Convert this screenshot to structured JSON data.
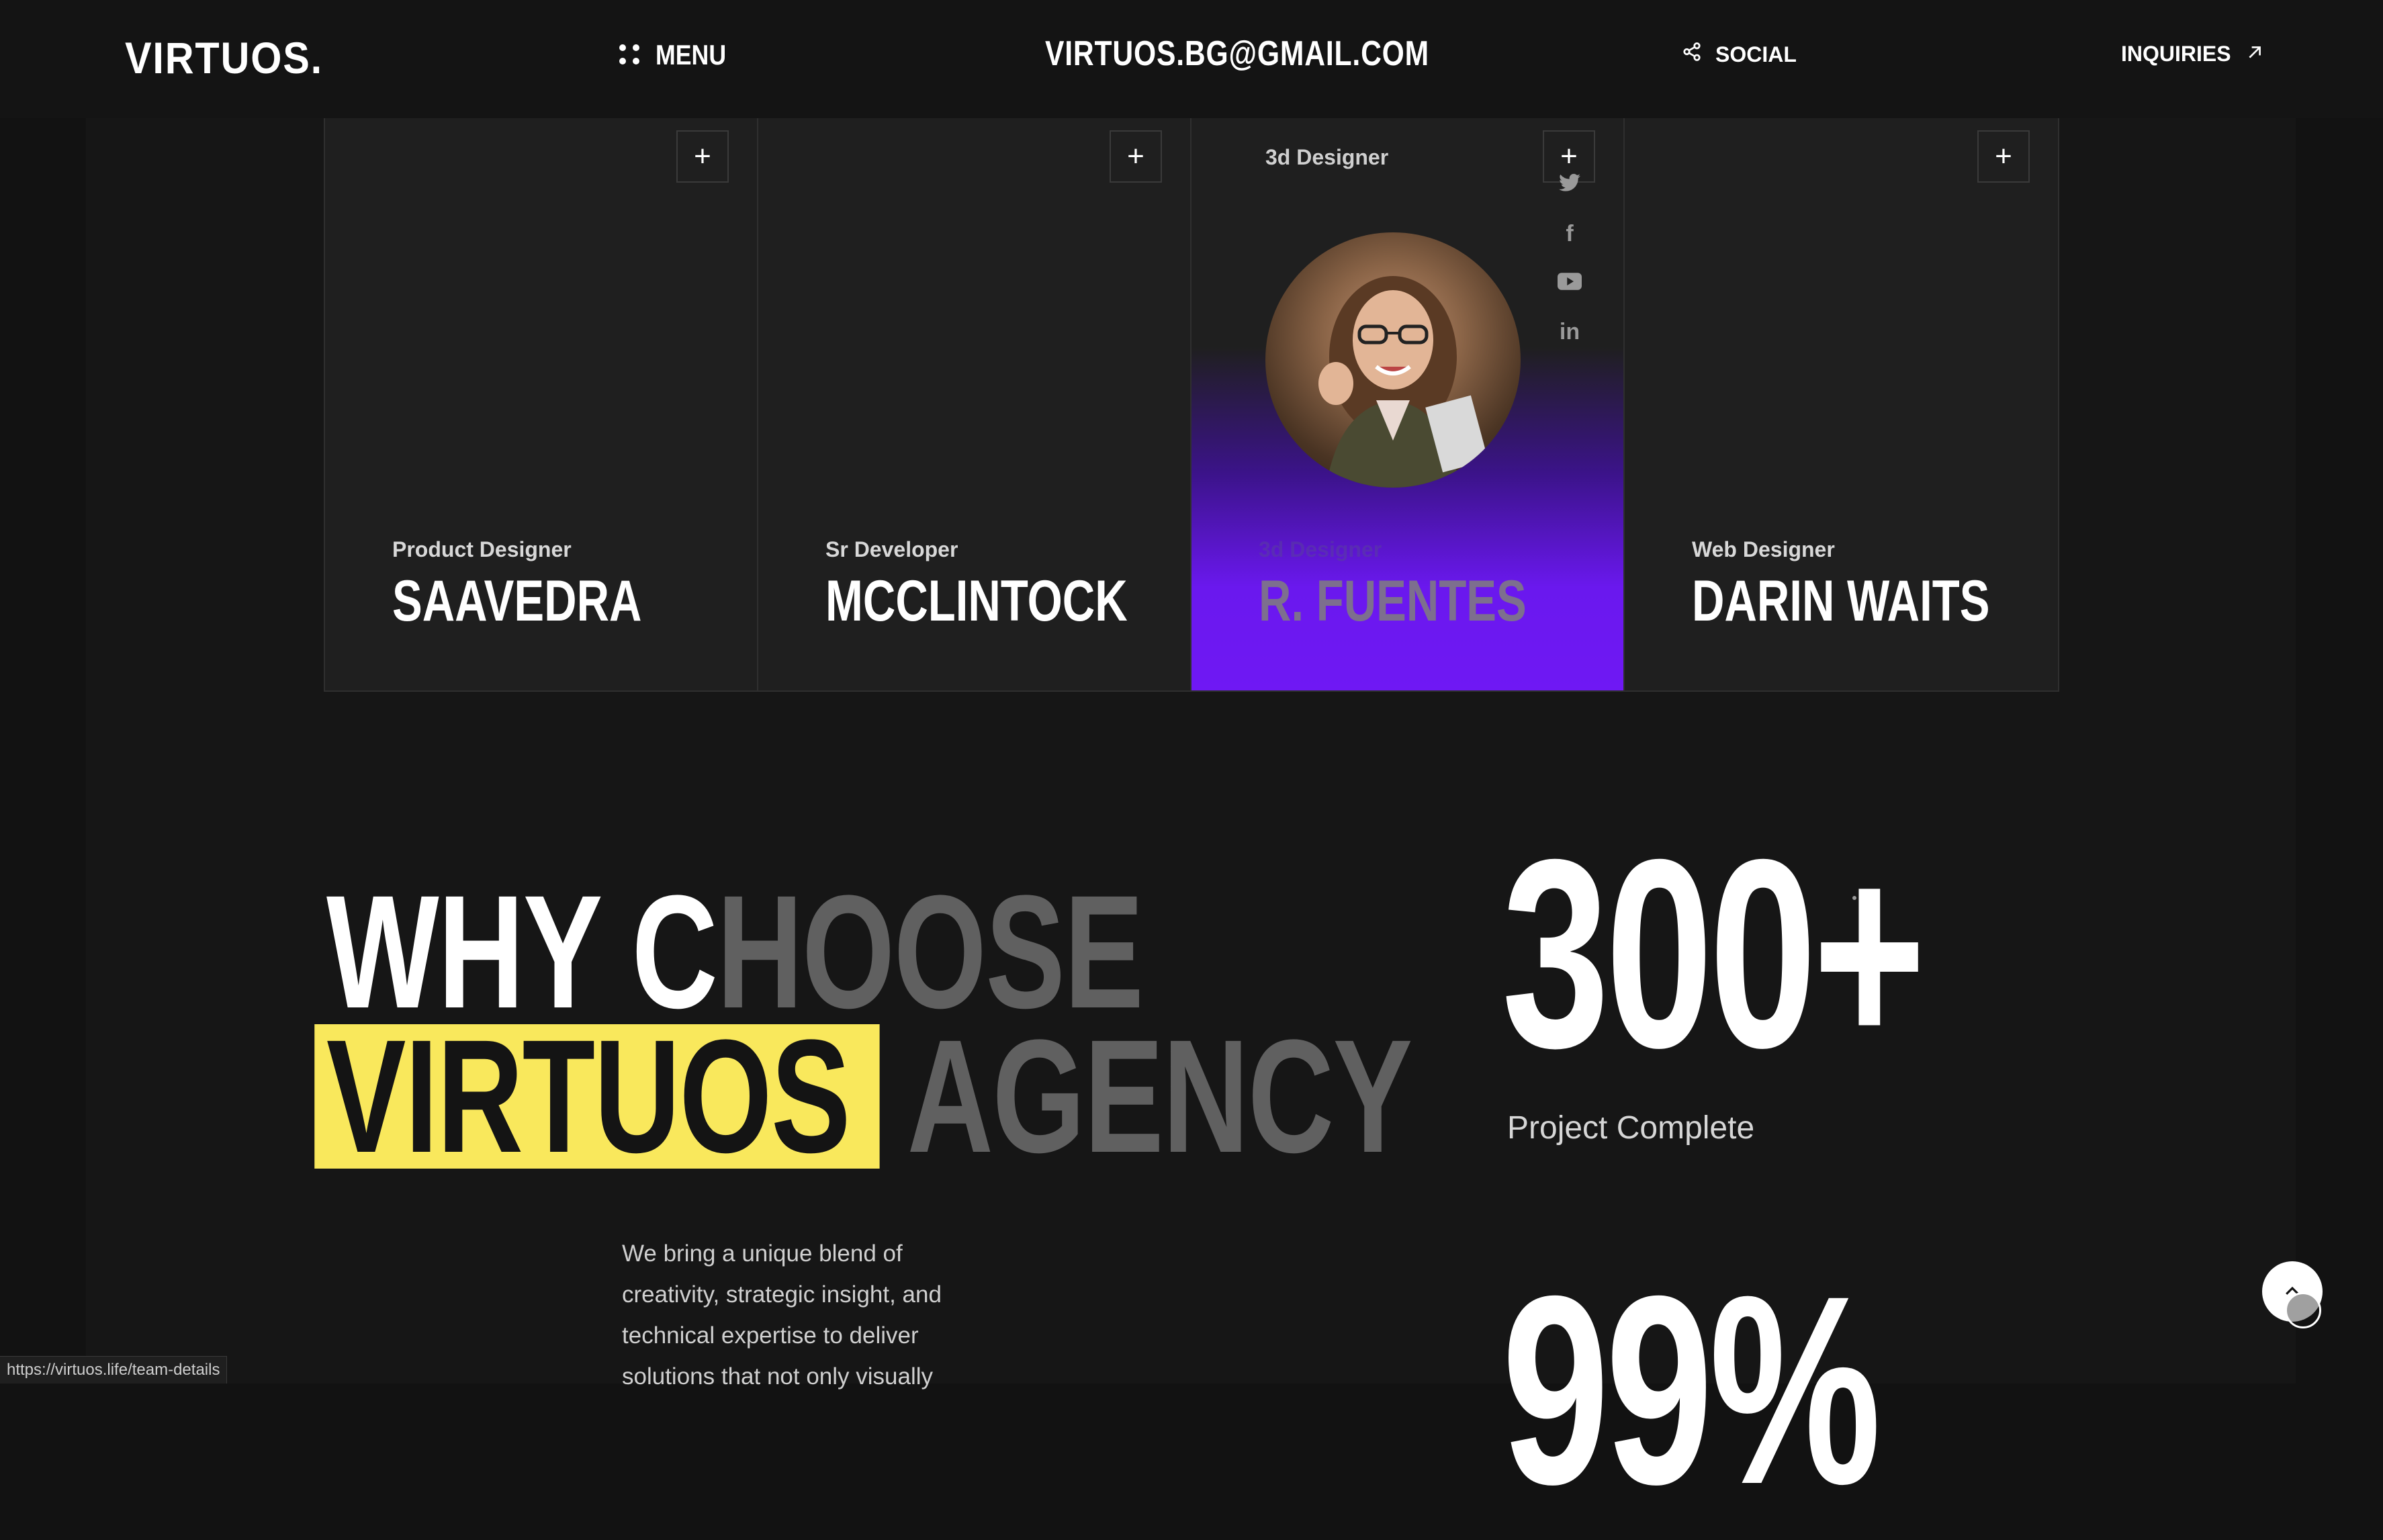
{
  "header": {
    "logo": "VIRTUOS.",
    "menu_label": "MENU",
    "email": "VIRTUOS.BG@GMAIL.COM",
    "social_label": "SOCIAL",
    "inquiries_label": "INQUIRIES"
  },
  "team": {
    "members": [
      {
        "role": "Product Designer",
        "name": "SAAVEDRA"
      },
      {
        "role": "Sr Developer",
        "name": "MCCLINTOCK"
      },
      {
        "role": "3d Designer",
        "name": "R. FUENTES"
      },
      {
        "role": "Web Designer",
        "name": "DARIN WAITS"
      }
    ],
    "plus_symbol": "+",
    "active_social_icons": [
      "twitter-icon",
      "facebook-icon",
      "youtube-icon",
      "linkedin-icon"
    ],
    "linkedin_text": "in",
    "facebook_text": "f"
  },
  "why": {
    "line1_bright": "WHY C",
    "line1_dim": "HOOSE",
    "line2_highlight": "VIRTUOS",
    "line2_dim": " AGENCY",
    "highlight_color": "#f9e85c",
    "description": "We bring a unique blend of creativity, strategic insight, and technical expertise to deliver solutions that not only visually"
  },
  "stats": {
    "first_value": "300+",
    "first_label": "Project Complete",
    "second_value": "99%"
  },
  "accent_color": "#6f18f4",
  "status_url": "https://virtuos.life/team-details"
}
